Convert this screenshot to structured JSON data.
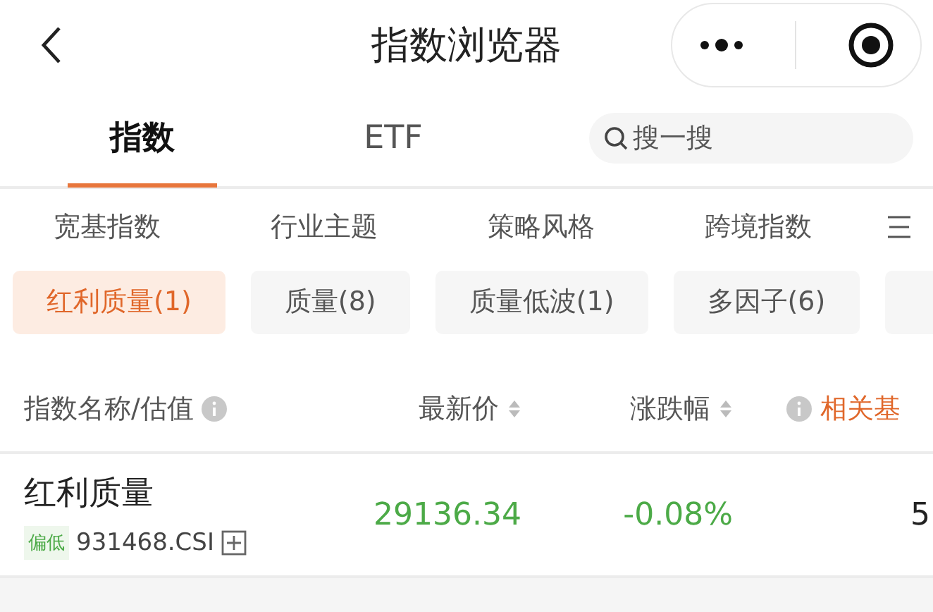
{
  "header": {
    "title": "指数浏览器"
  },
  "tabs": [
    {
      "label": "指数",
      "selected": true
    },
    {
      "label": "ETF",
      "selected": false
    }
  ],
  "search": {
    "placeholder": "搜一搜"
  },
  "categories": [
    {
      "label": "宽基指数"
    },
    {
      "label": "行业主题"
    },
    {
      "label": "策略风格"
    },
    {
      "label": "跨境指数"
    }
  ],
  "chips": [
    {
      "label": "红利质量(1)",
      "selected": true
    },
    {
      "label": "质量(8)",
      "selected": false
    },
    {
      "label": "质量低波(1)",
      "selected": false
    },
    {
      "label": "多因子(6)",
      "selected": false
    },
    {
      "selected": false
    }
  ],
  "table": {
    "columns": [
      {
        "label": "指数名称/估值",
        "kind": "info-after"
      },
      {
        "label": "最新价",
        "kind": "sort"
      },
      {
        "label": "涨跌幅",
        "kind": "sort"
      },
      {
        "label": "相关基",
        "kind": "info-before"
      }
    ],
    "rows": [
      {
        "name": "红利质量",
        "valuation": "偏低",
        "code": "931468.CSI",
        "price": "29136.34",
        "change": "-0.08%",
        "funds": "5"
      }
    ]
  }
}
